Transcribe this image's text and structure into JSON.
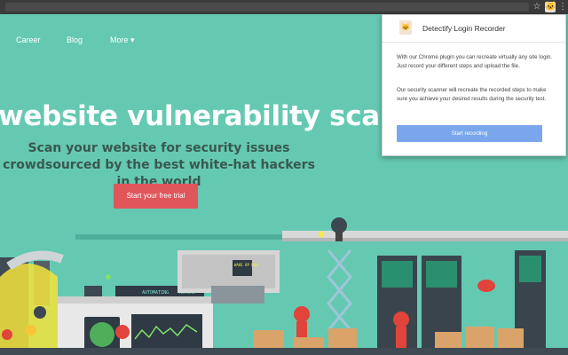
{
  "toolbar": {
    "star_icon": "star-icon",
    "extension_icon": "detectify-extension-icon",
    "menu_icon": "kebab-menu-icon"
  },
  "nav": {
    "items": [
      "Career",
      "Blog",
      "More ▾"
    ]
  },
  "hero": {
    "title": "website vulnerability scanner",
    "subtitle": "Scan your website for security issues crowdsourced by the best white-hat hackers in the world",
    "cta_label": "Start your free trial"
  },
  "scene": {
    "sign_text": "WAKE UP NEO...",
    "label_1": "AUTOMATING",
    "label_2": "AUTOMA"
  },
  "popup": {
    "title": "Detectify Login Recorder",
    "paragraph_1": "With our Chrome plugin you can recreate virtually any site login. Just record your different steps and upload the file.",
    "paragraph_2": "Our security scanner will recreate the recorded steps to make sure you achieve your desired results during the security test.",
    "button_label": "Start recording"
  },
  "colors": {
    "background": "#65c9b1",
    "cta": "#e0565b",
    "popup_button": "#7aa7ec",
    "robot": "#e0443b"
  }
}
